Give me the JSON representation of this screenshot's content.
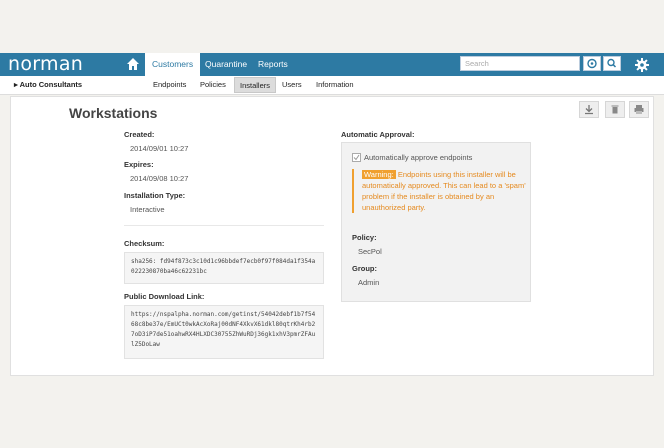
{
  "header": {
    "logo": "norman",
    "tabs": [
      {
        "label": "Customers",
        "active": true
      },
      {
        "label": "Quarantine",
        "active": false
      },
      {
        "label": "Reports",
        "active": false
      }
    ],
    "search_placeholder": "Search",
    "icons": [
      "home-icon",
      "target-icon",
      "search-icon",
      "gear-icon"
    ]
  },
  "subnav": {
    "breadcrumb": "Auto Consultants",
    "tabs": [
      {
        "label": "Endpoints",
        "active": false
      },
      {
        "label": "Policies",
        "active": false
      },
      {
        "label": "Installers",
        "active": true
      },
      {
        "label": "Users",
        "active": false
      },
      {
        "label": "Information",
        "active": false
      }
    ]
  },
  "page": {
    "title": "Workstations",
    "toolbar_icons": [
      "download-icon",
      "trash-icon",
      "print-icon"
    ],
    "created_label": "Created:",
    "created_value": "2014/09/01 10:27",
    "expires_label": "Expires:",
    "expires_value": "2014/09/08 10:27",
    "install_type_label": "Installation Type:",
    "install_type_value": "Interactive",
    "checksum_label": "Checksum:",
    "checksum_value": "sha256: fd94f873c3c10d1c96bbdef7ecb0f97f084da1f354a022230870ba46c62231bc",
    "download_label": "Public Download Link:",
    "download_value": "https://nspalpha.norman.com/getinst/54042debf1b7f5468c8be37e/EmUCt0wkAcXoRaj00dNF4XkvX61dkl80qtrKh4rb27oD3iP7de51oahwRX4HLXDC30755ZhWuRDj36gk1xhV3pmrZFAulZ5DoLaw",
    "approval_label": "Automatic Approval:",
    "approval_checkbox": "Automatically approve endpoints",
    "warning_tag": "Warning:",
    "warning_text": " Endpoints using this installer will be automatically approved. This can lead to a 'spam' problem if the installer is obtained by an unauthorized party.",
    "policy_label": "Policy:",
    "policy_value": "SecPol",
    "group_label": "Group:",
    "group_value": "Admin"
  },
  "colors": {
    "accent": "#2d7aa3",
    "warning": "#f0a030"
  }
}
